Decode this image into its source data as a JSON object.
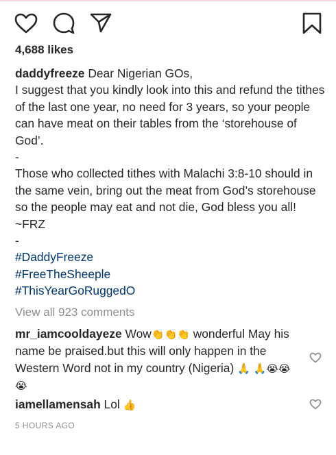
{
  "post": {
    "likes": "4,688 likes",
    "username": "daddyfreeze",
    "caption_first": "Dear Nigerian GOs,",
    "caption_body": "I suggest that you kindly look into this and refund the tithes of the last one year, no need for 3 years, so your people can have meat on their tables from the ‘storehouse of God’.\n-\nThose who collected tithes with Malachi 3:8-10 should in the same vein, bring out the meat from God’s storehouse so the people may eat and not die, God bless you all! ~FRZ\n-",
    "hashtags": [
      "#DaddyFreeze",
      "#FreeTheSheeple",
      "#ThisYearGoRuggedO"
    ],
    "view_all": "View all 923 comments",
    "timestamp": "5 HOURS AGO"
  },
  "comments": [
    {
      "username": "mr_iamcooldayeze",
      "text_a": "Wow",
      "emoji_a": "👏👏👏",
      "text_b": "wonderful May his name be praised.but this will only happen in the Western Word not in my country (Nigeria)",
      "emoji_b": "🙏",
      "emoji_c": "🙏😭😭😭"
    },
    {
      "username": "iamellamensah",
      "text_a": "Lol",
      "emoji_a": "👍"
    }
  ],
  "icons": [
    "heart-icon",
    "comment-icon",
    "share-icon",
    "bookmark-icon",
    "heart-small-icon"
  ]
}
